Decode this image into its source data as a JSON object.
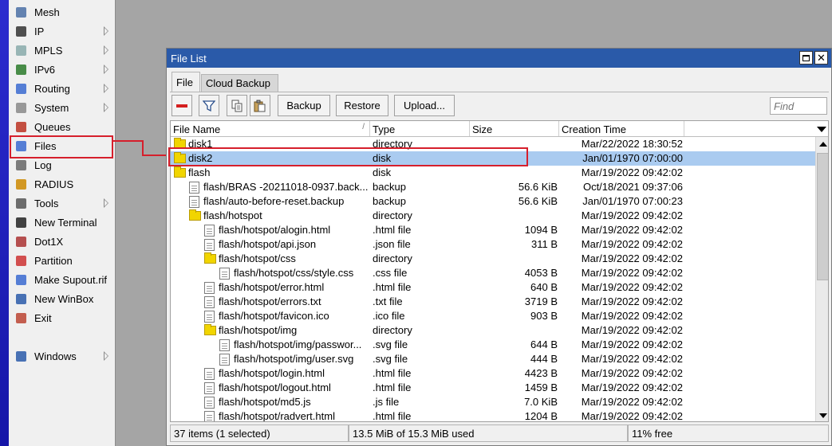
{
  "sidebar": {
    "items": [
      {
        "label": "Mesh",
        "icon": "mesh-icon",
        "has_submenu": false
      },
      {
        "label": "IP",
        "icon": "ip-icon",
        "has_submenu": true
      },
      {
        "label": "MPLS",
        "icon": "mpls-icon",
        "has_submenu": true
      },
      {
        "label": "IPv6",
        "icon": "ipv6-icon",
        "has_submenu": true
      },
      {
        "label": "Routing",
        "icon": "routing-icon",
        "has_submenu": true
      },
      {
        "label": "System",
        "icon": "gear-icon",
        "has_submenu": true
      },
      {
        "label": "Queues",
        "icon": "queues-icon",
        "has_submenu": false
      },
      {
        "label": "Files",
        "icon": "files-icon",
        "has_submenu": false
      },
      {
        "label": "Log",
        "icon": "log-icon",
        "has_submenu": false
      },
      {
        "label": "RADIUS",
        "icon": "radius-icon",
        "has_submenu": false
      },
      {
        "label": "Tools",
        "icon": "tools-icon",
        "has_submenu": true
      },
      {
        "label": "New Terminal",
        "icon": "terminal-icon",
        "has_submenu": false
      },
      {
        "label": "Dot1X",
        "icon": "dot1x-icon",
        "has_submenu": false
      },
      {
        "label": "Partition",
        "icon": "partition-icon",
        "has_submenu": false
      },
      {
        "label": "Make Supout.rif",
        "icon": "supout-icon",
        "has_submenu": false
      },
      {
        "label": "New WinBox",
        "icon": "winbox-icon",
        "has_submenu": false
      },
      {
        "label": "Exit",
        "icon": "exit-icon",
        "has_submenu": false
      },
      {
        "label": "Windows",
        "icon": "windows-icon",
        "has_submenu": true
      }
    ]
  },
  "window": {
    "title": "File List",
    "tabs": [
      "File",
      "Cloud Backup"
    ],
    "toolbar": {
      "backup_label": "Backup",
      "restore_label": "Restore",
      "upload_label": "Upload...",
      "find_placeholder": "Find"
    },
    "columns": [
      "File Name",
      "Type",
      "Size",
      "Creation Time"
    ],
    "rows": [
      {
        "name": "disk1",
        "type": "directory",
        "size": "",
        "time": "Mar/22/2022 18:30:52",
        "kind": "folder",
        "indent": 0,
        "selected": false
      },
      {
        "name": "disk2",
        "type": "disk",
        "size": "",
        "time": "Jan/01/1970 07:00:00",
        "kind": "folder",
        "indent": 0,
        "selected": true
      },
      {
        "name": "flash",
        "type": "disk",
        "size": "",
        "time": "Mar/19/2022 09:42:02",
        "kind": "folder",
        "indent": 0,
        "selected": false
      },
      {
        "name": "flash/BRAS -20211018-0937.back...",
        "type": "backup",
        "size": "56.6 KiB",
        "time": "Oct/18/2021 09:37:06",
        "kind": "file",
        "indent": 1,
        "selected": false
      },
      {
        "name": "flash/auto-before-reset.backup",
        "type": "backup",
        "size": "56.6 KiB",
        "time": "Jan/01/1970 07:00:23",
        "kind": "file",
        "indent": 1,
        "selected": false
      },
      {
        "name": "flash/hotspot",
        "type": "directory",
        "size": "",
        "time": "Mar/19/2022 09:42:02",
        "kind": "folder",
        "indent": 1,
        "selected": false
      },
      {
        "name": "flash/hotspot/alogin.html",
        "type": ".html file",
        "size": "1094 B",
        "time": "Mar/19/2022 09:42:02",
        "kind": "file",
        "indent": 2,
        "selected": false
      },
      {
        "name": "flash/hotspot/api.json",
        "type": ".json file",
        "size": "311 B",
        "time": "Mar/19/2022 09:42:02",
        "kind": "file",
        "indent": 2,
        "selected": false
      },
      {
        "name": "flash/hotspot/css",
        "type": "directory",
        "size": "",
        "time": "Mar/19/2022 09:42:02",
        "kind": "folder",
        "indent": 2,
        "selected": false
      },
      {
        "name": "flash/hotspot/css/style.css",
        "type": ".css file",
        "size": "4053 B",
        "time": "Mar/19/2022 09:42:02",
        "kind": "file",
        "indent": 3,
        "selected": false
      },
      {
        "name": "flash/hotspot/error.html",
        "type": ".html file",
        "size": "640 B",
        "time": "Mar/19/2022 09:42:02",
        "kind": "file",
        "indent": 2,
        "selected": false
      },
      {
        "name": "flash/hotspot/errors.txt",
        "type": ".txt file",
        "size": "3719 B",
        "time": "Mar/19/2022 09:42:02",
        "kind": "file",
        "indent": 2,
        "selected": false
      },
      {
        "name": "flash/hotspot/favicon.ico",
        "type": ".ico file",
        "size": "903 B",
        "time": "Mar/19/2022 09:42:02",
        "kind": "file",
        "indent": 2,
        "selected": false
      },
      {
        "name": "flash/hotspot/img",
        "type": "directory",
        "size": "",
        "time": "Mar/19/2022 09:42:02",
        "kind": "folder",
        "indent": 2,
        "selected": false
      },
      {
        "name": "flash/hotspot/img/passwor...",
        "type": ".svg file",
        "size": "644 B",
        "time": "Mar/19/2022 09:42:02",
        "kind": "file",
        "indent": 3,
        "selected": false
      },
      {
        "name": "flash/hotspot/img/user.svg",
        "type": ".svg file",
        "size": "444 B",
        "time": "Mar/19/2022 09:42:02",
        "kind": "file",
        "indent": 3,
        "selected": false
      },
      {
        "name": "flash/hotspot/login.html",
        "type": ".html file",
        "size": "4423 B",
        "time": "Mar/19/2022 09:42:02",
        "kind": "file",
        "indent": 2,
        "selected": false
      },
      {
        "name": "flash/hotspot/logout.html",
        "type": ".html file",
        "size": "1459 B",
        "time": "Mar/19/2022 09:42:02",
        "kind": "file",
        "indent": 2,
        "selected": false
      },
      {
        "name": "flash/hotspot/md5.js",
        "type": ".js file",
        "size": "7.0 KiB",
        "time": "Mar/19/2022 09:42:02",
        "kind": "file",
        "indent": 2,
        "selected": false
      },
      {
        "name": "flash/hotspot/radvert.html",
        "type": ".html file",
        "size": "1204 B",
        "time": "Mar/19/2022 09:42:02",
        "kind": "file",
        "indent": 2,
        "selected": false
      }
    ],
    "status": {
      "items": "37 items (1 selected)",
      "usage": "13.5 MiB of 15.3 MiB used",
      "free": "11% free"
    }
  },
  "colors": {
    "titlebar": "#2a5aa9",
    "selection": "#aacbf0",
    "annotation_red": "#d61f2c",
    "sidebar_strip": "#1f1fb8"
  }
}
